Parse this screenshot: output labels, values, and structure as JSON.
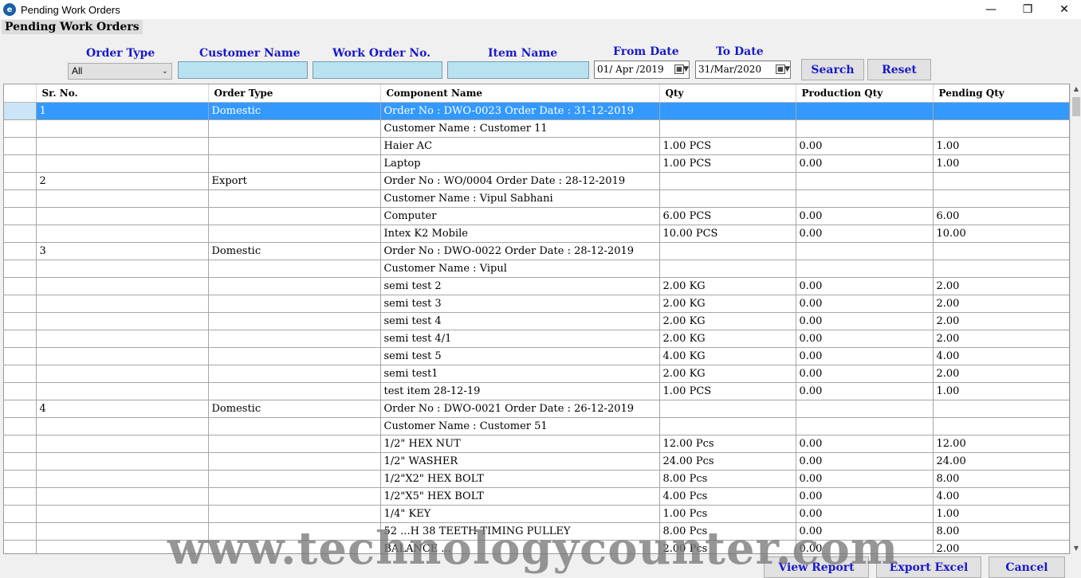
{
  "window": {
    "title": "Pending Work Orders",
    "icon": "app-logo-icon",
    "minimize_glyph": "—",
    "maximize_glyph": "❐",
    "close_glyph": "✕"
  },
  "page_heading": "Pending Work Orders",
  "filters": {
    "order_type_label": "Order Type",
    "order_type_value": "All",
    "customer_name_label": "Customer Name",
    "customer_name_value": "",
    "work_order_no_label": "Work Order No.",
    "work_order_no_value": "",
    "item_name_label": "Item Name",
    "item_name_value": "",
    "from_date_label": "From Date",
    "from_date_value": "01/ Apr /2019",
    "to_date_label": "To Date",
    "to_date_value": "31/Mar/2020"
  },
  "buttons": {
    "search": "Search",
    "reset": "Reset",
    "view_report": "View Report",
    "export_excel": "Export Excel",
    "cancel": "Cancel"
  },
  "grid": {
    "columns": [
      "Sr. No.",
      "Order Type",
      "Component Name",
      "Qty",
      "Production Qty",
      "Pending Qty"
    ],
    "rows": [
      [
        "1",
        "Domestic",
        "Order No : DWO-0023 Order Date : 31-12-2019",
        "",
        "",
        ""
      ],
      [
        "",
        "",
        "Customer Name : Customer 11",
        "",
        "",
        ""
      ],
      [
        "",
        "",
        "Haier AC",
        "1.00 PCS",
        "0.00",
        "1.00"
      ],
      [
        "",
        "",
        "Laptop",
        "1.00 PCS",
        "0.00",
        "1.00"
      ],
      [
        "2",
        "Export",
        "Order No : WO/0004 Order Date : 28-12-2019",
        "",
        "",
        ""
      ],
      [
        "",
        "",
        "Customer Name : Vipul Sabhani",
        "",
        "",
        ""
      ],
      [
        "",
        "",
        "Computer",
        "6.00 PCS",
        "0.00",
        "6.00"
      ],
      [
        "",
        "",
        "Intex K2 Mobile",
        "10.00 PCS",
        "0.00",
        "10.00"
      ],
      [
        "3",
        "Domestic",
        "Order No : DWO-0022 Order Date : 28-12-2019",
        "",
        "",
        ""
      ],
      [
        "",
        "",
        "Customer Name : Vipul",
        "",
        "",
        ""
      ],
      [
        "",
        "",
        "semi test 2",
        "2.00 KG",
        "0.00",
        "2.00"
      ],
      [
        "",
        "",
        "semi test 3",
        "2.00 KG",
        "0.00",
        "2.00"
      ],
      [
        "",
        "",
        "semi test 4",
        "2.00 KG",
        "0.00",
        "2.00"
      ],
      [
        "",
        "",
        "semi test 4/1",
        "2.00 KG",
        "0.00",
        "2.00"
      ],
      [
        "",
        "",
        "semi test 5",
        "4.00 KG",
        "0.00",
        "4.00"
      ],
      [
        "",
        "",
        "semi test1",
        "2.00 KG",
        "0.00",
        "2.00"
      ],
      [
        "",
        "",
        "test item 28-12-19",
        "1.00 PCS",
        "0.00",
        "1.00"
      ],
      [
        "4",
        "Domestic",
        "Order No : DWO-0021 Order Date : 26-12-2019",
        "",
        "",
        ""
      ],
      [
        "",
        "",
        "Customer Name : Customer 51",
        "",
        "",
        ""
      ],
      [
        "",
        "",
        "1/2\" HEX NUT",
        "12.00 Pcs",
        "0.00",
        "12.00"
      ],
      [
        "",
        "",
        "1/2\" WASHER",
        "24.00 Pcs",
        "0.00",
        "24.00"
      ],
      [
        "",
        "",
        "1/2\"X2\" HEX BOLT",
        "8.00 Pcs",
        "0.00",
        "8.00"
      ],
      [
        "",
        "",
        "1/2\"X5\" HEX BOLT",
        "4.00 Pcs",
        "0.00",
        "4.00"
      ],
      [
        "",
        "",
        "1/4\" KEY",
        "1.00 Pcs",
        "0.00",
        "1.00"
      ],
      [
        "",
        "",
        "52 ...H 38 TEETH TIMING PULLEY",
        "8.00 Pcs",
        "0.00",
        "8.00"
      ],
      [
        "",
        "",
        "BALANCE ...",
        "2.00 Pcs",
        "0.00",
        "2.00"
      ]
    ],
    "selected_row_index": 0
  },
  "watermark": "www.technologycounter.com",
  "colors": {
    "label_blue": "#1a1ac8",
    "selection": "#3399ff",
    "input_fill": "#b8e2f0"
  }
}
